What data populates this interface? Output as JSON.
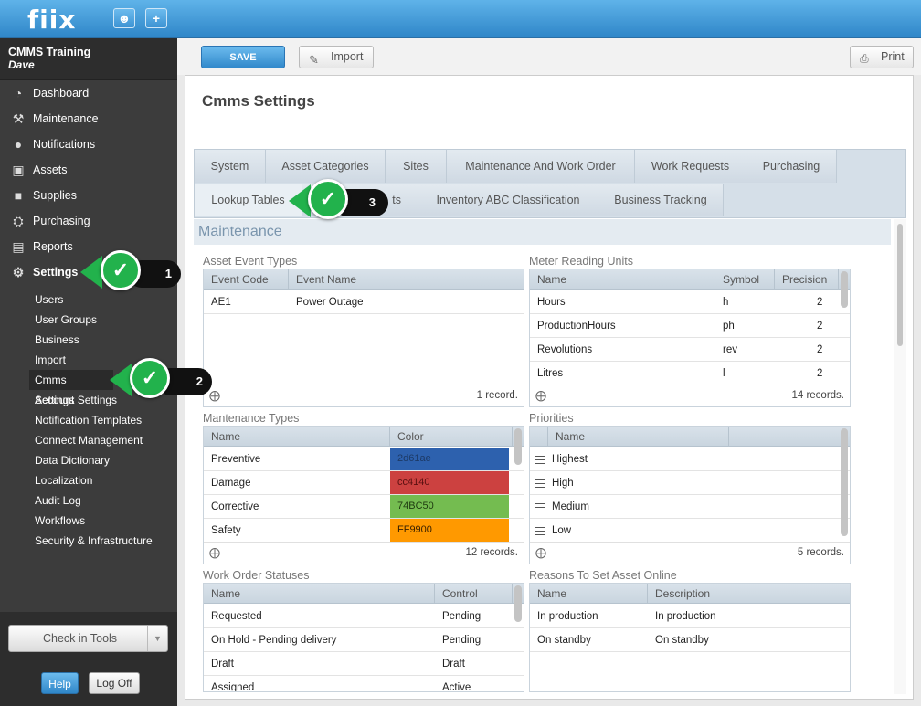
{
  "app": {
    "logo": "fiix",
    "brand_color": "#3a92d3"
  },
  "topbar": {
    "user_icon": "person-icon",
    "add_label": "+"
  },
  "account": {
    "name": "CMMS Training",
    "user": "Dave"
  },
  "nav": [
    {
      "label": "Dashboard",
      "icon": "dashboard-icon"
    },
    {
      "label": "Maintenance",
      "icon": "tools-icon"
    },
    {
      "label": "Notifications",
      "icon": "chat-bubble-icon"
    },
    {
      "label": "Assets",
      "icon": "boxes-icon"
    },
    {
      "label": "Supplies",
      "icon": "truck-icon"
    },
    {
      "label": "Purchasing",
      "icon": "cart-icon"
    },
    {
      "label": "Reports",
      "icon": "chart-icon"
    },
    {
      "label": "Settings",
      "icon": "gear-icon"
    }
  ],
  "settings_sub": [
    "Users",
    "User Groups",
    "Business",
    "Import",
    "Cmms Settings",
    "Account Settings",
    "Notification Templates",
    "Connect Management",
    "Data Dictionary",
    "Localization",
    "Audit Log",
    "Workflows",
    "Security & Infrastructure"
  ],
  "sidebar_footer": {
    "check_in": "Check in Tools",
    "help": "Help",
    "logoff": "Log Off"
  },
  "toolbar": {
    "save": "SAVE",
    "import": "Import",
    "print": "Print"
  },
  "page": {
    "title": "Cmms Settings",
    "section": "Maintenance"
  },
  "tabs_row1": [
    "System",
    "Asset Categories",
    "Sites",
    "Maintenance And Work Order",
    "Work Requests",
    "Purchasing"
  ],
  "tabs_row2": [
    "Lookup Tables",
    "ts",
    "Inventory ABC Classification",
    "Business Tracking"
  ],
  "markers": [
    "1",
    "2",
    "3"
  ],
  "asset_event_types": {
    "label": "Asset Event Types",
    "headers": [
      "Event Code",
      "Event Name"
    ],
    "rows": [
      [
        "AE1",
        "Power Outage"
      ]
    ],
    "count": "1 record."
  },
  "meter_reading_units": {
    "label": "Meter Reading Units",
    "headers": [
      "Name",
      "Symbol",
      "Precision"
    ],
    "rows": [
      [
        "Hours",
        "h",
        "2"
      ],
      [
        "ProductionHours",
        "ph",
        "2"
      ],
      [
        "Revolutions",
        "rev",
        "2"
      ],
      [
        "Litres",
        "l",
        "2"
      ]
    ],
    "count": "14 records."
  },
  "maintenance_types": {
    "label": "Mantenance Types",
    "headers": [
      "Name",
      "Color"
    ],
    "rows": [
      [
        "Preventive",
        "2d61ae",
        "#2d61ae",
        "#1d3a66"
      ],
      [
        "Damage",
        "cc4140",
        "#cc4140",
        "#5a1010"
      ],
      [
        "Corrective",
        "74BC50",
        "#74bc50",
        "#1e3a10"
      ],
      [
        "Safety",
        "FF9900",
        "#ff9900",
        "#3a2200"
      ]
    ],
    "count": "12 records."
  },
  "priorities": {
    "label": "Priorities",
    "headers": [
      "Name"
    ],
    "rows": [
      "Highest",
      "High",
      "Medium",
      "Low"
    ],
    "count": "5 records."
  },
  "work_order_statuses": {
    "label": "Work Order Statuses",
    "headers": [
      "Name",
      "Control"
    ],
    "rows": [
      [
        "Requested",
        "Pending"
      ],
      [
        "On Hold - Pending delivery",
        "Pending"
      ],
      [
        "Draft",
        "Draft"
      ],
      [
        "Assigned",
        "Active"
      ]
    ]
  },
  "reasons_online": {
    "label": "Reasons To Set Asset Online",
    "headers": [
      "Name",
      "Description"
    ],
    "rows": [
      [
        "In production",
        "In production"
      ],
      [
        "On standby",
        "On standby"
      ]
    ]
  }
}
